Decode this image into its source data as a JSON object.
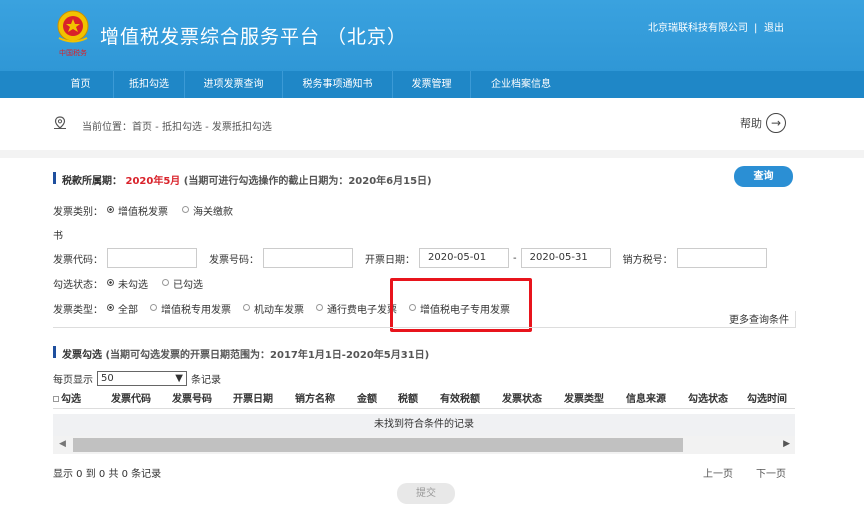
{
  "header": {
    "title": "增值税发票综合服务平台 （北京）",
    "company": "北京瑞联科技有限公司",
    "separator": "|",
    "logout": "退出",
    "logo_text": "中国税务"
  },
  "nav": {
    "items": [
      {
        "label": "首页"
      },
      {
        "label": "抵扣勾选"
      },
      {
        "label": "进项发票查询"
      },
      {
        "label": "税务事项通知书"
      },
      {
        "label": "发票管理"
      },
      {
        "label": "企业档案信息"
      }
    ]
  },
  "breadcrumb": {
    "text": "当前位置：首页 - 抵扣勾选 - 发票抵扣勾选",
    "help": "帮助"
  },
  "period": {
    "label": "税款所属期：",
    "value": "2020年5月",
    "note": "(当期可进行勾选操作的截止日期为：2020年6月15日)",
    "query_button": "查询"
  },
  "filters": {
    "invoice_category_label": "发票类别：",
    "invoice_category_options": [
      {
        "label": "增值税发票",
        "selected": true
      },
      {
        "label": "海关缴款",
        "selected": false
      }
    ],
    "category_wrap": "书",
    "code_label": "发票代码：",
    "code_value": "",
    "number_label": "发票号码：",
    "number_value": "",
    "date_label": "开票日期：",
    "date_from": "2020-05-01",
    "date_dash": "-",
    "date_to": "2020-05-31",
    "seller_tax_label": "销方税号：",
    "seller_tax_value": "",
    "check_status_label": "勾选状态：",
    "check_status_options": [
      {
        "label": "未勾选",
        "selected": true
      },
      {
        "label": "已勾选",
        "selected": false
      }
    ],
    "invoice_type_label": "发票类型：",
    "invoice_type_options": [
      {
        "label": "全部",
        "selected": true
      },
      {
        "label": "增值税专用发票",
        "selected": false
      },
      {
        "label": "机动车发票",
        "selected": false
      },
      {
        "label": "通行费电子发票",
        "selected": false
      },
      {
        "label": "增值税电子专用发票",
        "selected": false
      }
    ],
    "more_conditions": "更多查询条件"
  },
  "invoice_section": {
    "title": "发票勾选",
    "note": "(当期可勾选发票的开票日期范围为：2017年1月1日-2020年5月31日)",
    "page_size_label": "每页显示",
    "page_size_value": "50",
    "page_size_suffix": "条记录",
    "columns": [
      "勾选",
      "发票代码",
      "发票号码",
      "开票日期",
      "销方名称",
      "金额",
      "税额",
      "有效税额",
      "发票状态",
      "发票类型",
      "信息来源",
      "勾选状态",
      "勾选时间"
    ],
    "empty_text": "未找到符合条件的记录",
    "record_info": "显示 0 到 0 共 0 条记录",
    "prev": "上一页",
    "next": "下一页",
    "submit": "提交"
  }
}
